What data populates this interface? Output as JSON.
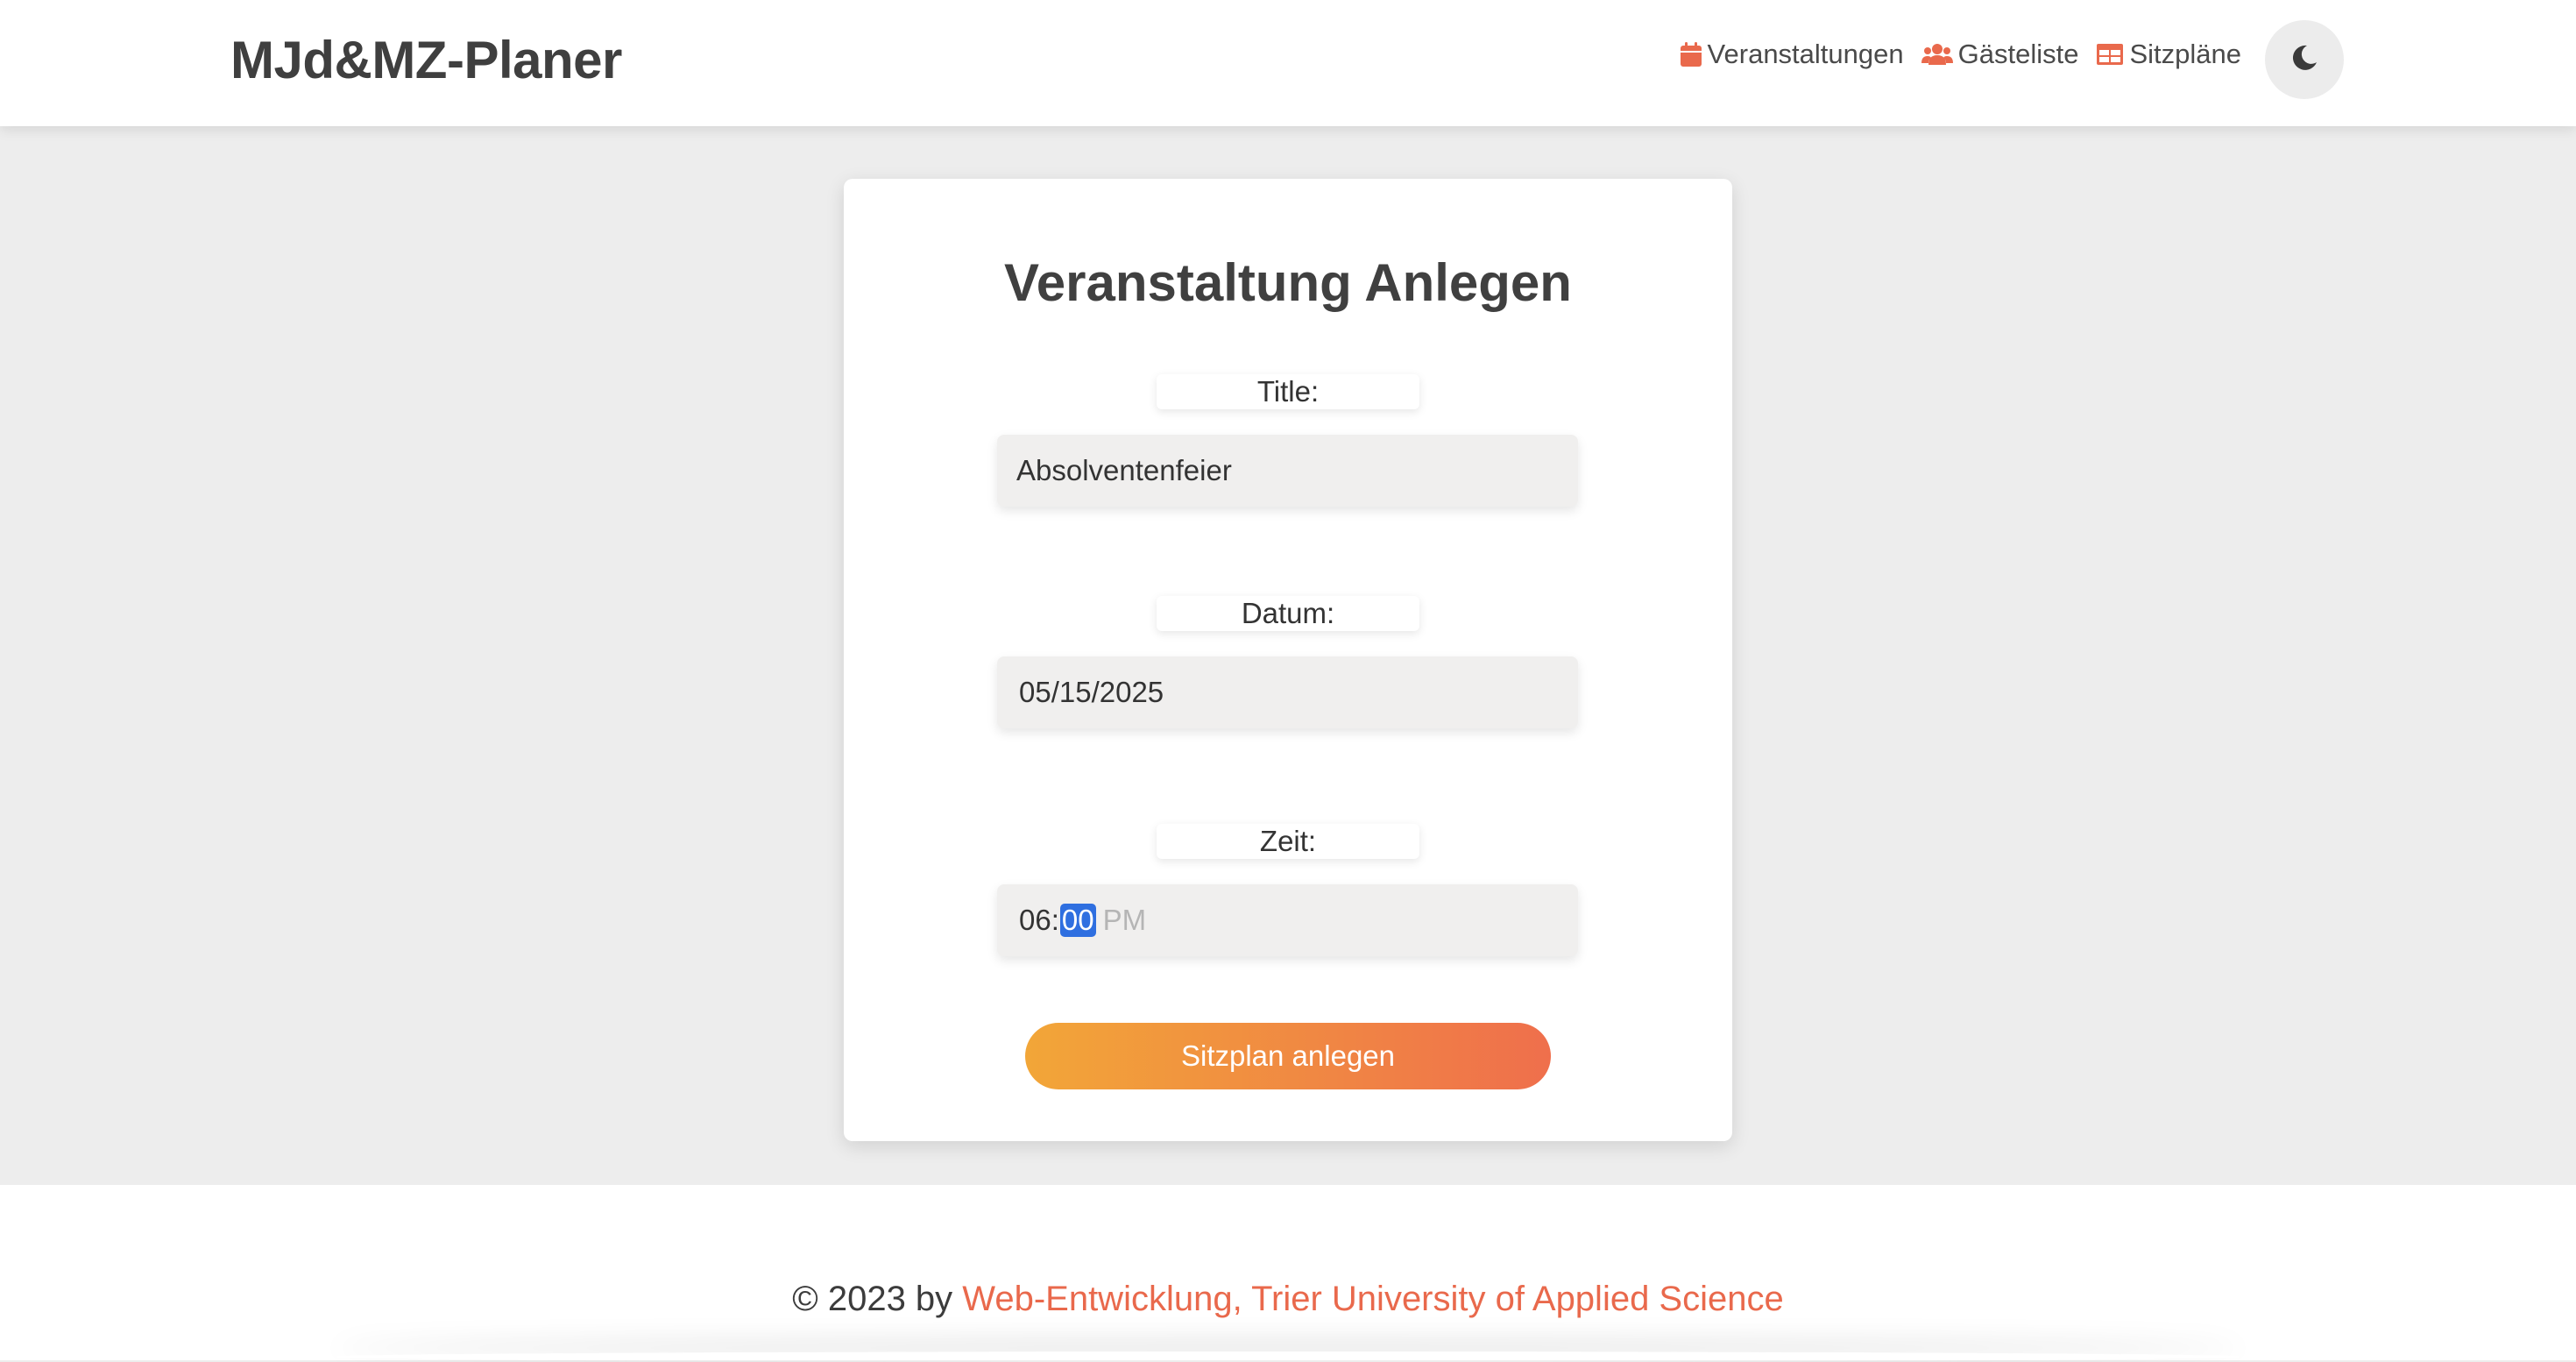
{
  "header": {
    "brand": "MJd&MZ-Planer",
    "nav": [
      {
        "label": "Veranstaltungen",
        "icon": "calendar-icon"
      },
      {
        "label": "Gästeliste",
        "icon": "users-icon"
      },
      {
        "label": "Sitzpläne",
        "icon": "table-icon"
      }
    ],
    "theme_toggle_icon": "moon-icon"
  },
  "form": {
    "title": "Veranstaltung Anlegen",
    "title_field": {
      "label": "Title:",
      "value": "Absolventenfeier"
    },
    "date_field": {
      "label": "Datum:",
      "value": "05/15/2025"
    },
    "time_field": {
      "label": "Zeit:",
      "hour": "06",
      "separator": ":",
      "minute": "00",
      "ampm": "PM"
    },
    "submit_label": "Sitzplan anlegen"
  },
  "footer": {
    "prefix": "© 2023 by ",
    "link_text": "Web-Entwicklung, Trier University of Applied Science"
  },
  "colors": {
    "accent": "#e9694c",
    "gradient_start": "#f2a638",
    "gradient_end": "#ef6f4c",
    "selection": "#2f6fe0"
  }
}
